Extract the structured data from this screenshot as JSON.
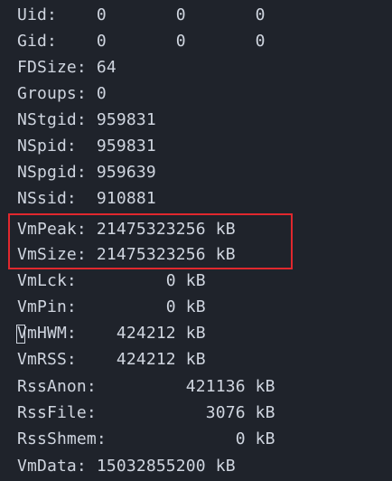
{
  "terminal": {
    "lines": [
      "Uid:\t0\t0\t0",
      "Gid:\t0\t0\t0",
      "FDSize:\t64",
      "Groups:\t0",
      "NStgid:\t959831",
      "NSpid:\t959831",
      "NSpgid:\t959639",
      "NSsid:\t910881",
      "VmPeak:\t21475323256 kB",
      "VmSize:\t21475323256 kB",
      "VmLck:\t       0 kB",
      "VmPin:\t       0 kB",
      "VmHWM:\t  424212 kB",
      "VmRSS:\t  424212 kB",
      "RssAnon:\t          421136 kB",
      "RssFile:\t            3076 kB",
      "RssShmem:\t               0 kB",
      "VmData:\t15032855200 kB"
    ],
    "display": [
      "Uid:    0       0       0",
      "Gid:    0       0       0",
      "FDSize: 64",
      "Groups: 0",
      "NStgid: 959831",
      "NSpid:  959831",
      "NSpgid: 959639",
      "NSsid:  910881",
      "VmPeak: 21475323256 kB",
      "VmSize: 21475323256 kB",
      "VmLck:         0 kB",
      "VmPin:         0 kB",
      "VmHWM:    424212 kB",
      "VmRSS:    424212 kB",
      "RssAnon:         421136 kB",
      "RssFile:           3076 kB",
      "RssShmem:             0 kB",
      "VmData: 15032855200 kB"
    ],
    "highlighted_lines": [
      "VmPeak",
      "VmSize"
    ],
    "colors": {
      "background": "#1f232b",
      "text": "#cfd5df",
      "highlight_border": "#e0282e"
    }
  }
}
